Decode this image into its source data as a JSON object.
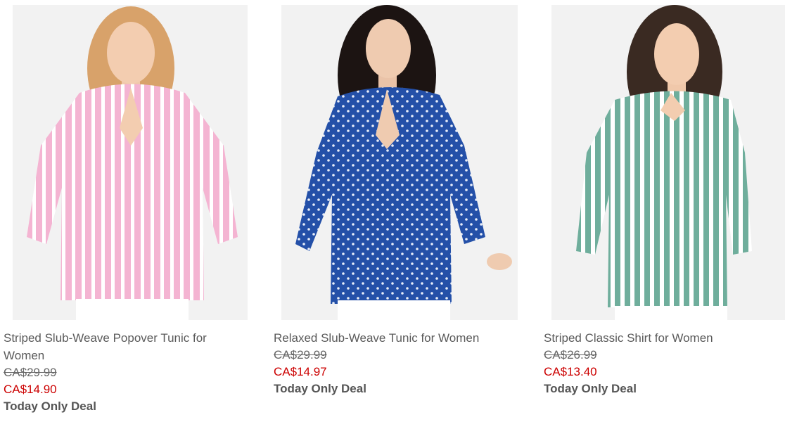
{
  "products": [
    {
      "name": "Striped Slub-Weave Popover Tunic for Women",
      "was_price": "CA$29.99",
      "now_price": "CA$14.90",
      "deal": "Today Only Deal",
      "shirt_color": "#f4b4d2",
      "stripe_color": "#ffffff",
      "pattern": "stripes",
      "hair_color": "#d8a26a"
    },
    {
      "name": "Relaxed Slub-Weave Tunic for Women",
      "was_price": "CA$29.99",
      "now_price": "CA$14.97",
      "deal": "Today Only Deal",
      "shirt_color": "#2450a8",
      "stripe_color": "#e8eefa",
      "pattern": "dots",
      "hair_color": "#1c1412"
    },
    {
      "name": "Striped Classic Shirt for Women",
      "was_price": "CA$26.99",
      "now_price": "CA$13.40",
      "deal": "Today Only Deal",
      "shirt_color": "#6fae9c",
      "stripe_color": "#ffffff",
      "pattern": "stripes",
      "hair_color": "#3a2a22"
    }
  ]
}
